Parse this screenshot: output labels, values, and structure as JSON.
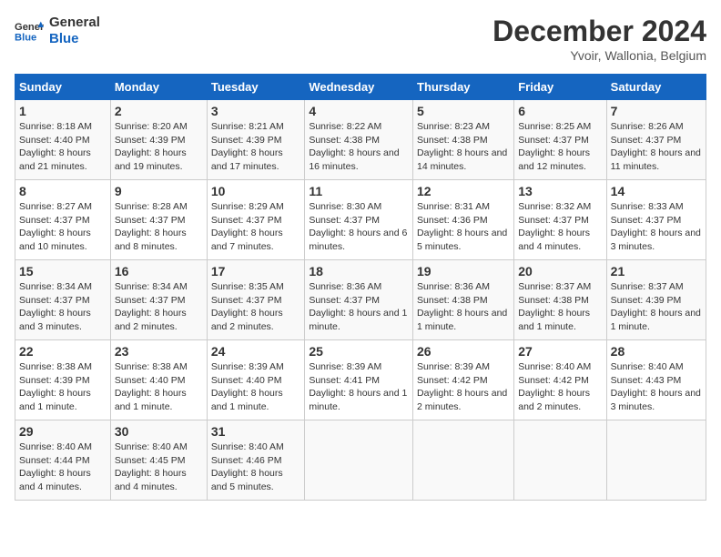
{
  "logo": {
    "text_general": "General",
    "text_blue": "Blue"
  },
  "header": {
    "month": "December 2024",
    "location": "Yvoir, Wallonia, Belgium"
  },
  "days_of_week": [
    "Sunday",
    "Monday",
    "Tuesday",
    "Wednesday",
    "Thursday",
    "Friday",
    "Saturday"
  ],
  "weeks": [
    [
      {
        "day": "1",
        "sunrise": "8:18 AM",
        "sunset": "4:40 PM",
        "daylight": "8 hours and 21 minutes."
      },
      {
        "day": "2",
        "sunrise": "8:20 AM",
        "sunset": "4:39 PM",
        "daylight": "8 hours and 19 minutes."
      },
      {
        "day": "3",
        "sunrise": "8:21 AM",
        "sunset": "4:39 PM",
        "daylight": "8 hours and 17 minutes."
      },
      {
        "day": "4",
        "sunrise": "8:22 AM",
        "sunset": "4:38 PM",
        "daylight": "8 hours and 16 minutes."
      },
      {
        "day": "5",
        "sunrise": "8:23 AM",
        "sunset": "4:38 PM",
        "daylight": "8 hours and 14 minutes."
      },
      {
        "day": "6",
        "sunrise": "8:25 AM",
        "sunset": "4:37 PM",
        "daylight": "8 hours and 12 minutes."
      },
      {
        "day": "7",
        "sunrise": "8:26 AM",
        "sunset": "4:37 PM",
        "daylight": "8 hours and 11 minutes."
      }
    ],
    [
      {
        "day": "8",
        "sunrise": "8:27 AM",
        "sunset": "4:37 PM",
        "daylight": "8 hours and 10 minutes."
      },
      {
        "day": "9",
        "sunrise": "8:28 AM",
        "sunset": "4:37 PM",
        "daylight": "8 hours and 8 minutes."
      },
      {
        "day": "10",
        "sunrise": "8:29 AM",
        "sunset": "4:37 PM",
        "daylight": "8 hours and 7 minutes."
      },
      {
        "day": "11",
        "sunrise": "8:30 AM",
        "sunset": "4:37 PM",
        "daylight": "8 hours and 6 minutes."
      },
      {
        "day": "12",
        "sunrise": "8:31 AM",
        "sunset": "4:36 PM",
        "daylight": "8 hours and 5 minutes."
      },
      {
        "day": "13",
        "sunrise": "8:32 AM",
        "sunset": "4:37 PM",
        "daylight": "8 hours and 4 minutes."
      },
      {
        "day": "14",
        "sunrise": "8:33 AM",
        "sunset": "4:37 PM",
        "daylight": "8 hours and 3 minutes."
      }
    ],
    [
      {
        "day": "15",
        "sunrise": "8:34 AM",
        "sunset": "4:37 PM",
        "daylight": "8 hours and 3 minutes."
      },
      {
        "day": "16",
        "sunrise": "8:34 AM",
        "sunset": "4:37 PM",
        "daylight": "8 hours and 2 minutes."
      },
      {
        "day": "17",
        "sunrise": "8:35 AM",
        "sunset": "4:37 PM",
        "daylight": "8 hours and 2 minutes."
      },
      {
        "day": "18",
        "sunrise": "8:36 AM",
        "sunset": "4:37 PM",
        "daylight": "8 hours and 1 minute."
      },
      {
        "day": "19",
        "sunrise": "8:36 AM",
        "sunset": "4:38 PM",
        "daylight": "8 hours and 1 minute."
      },
      {
        "day": "20",
        "sunrise": "8:37 AM",
        "sunset": "4:38 PM",
        "daylight": "8 hours and 1 minute."
      },
      {
        "day": "21",
        "sunrise": "8:37 AM",
        "sunset": "4:39 PM",
        "daylight": "8 hours and 1 minute."
      }
    ],
    [
      {
        "day": "22",
        "sunrise": "8:38 AM",
        "sunset": "4:39 PM",
        "daylight": "8 hours and 1 minute."
      },
      {
        "day": "23",
        "sunrise": "8:38 AM",
        "sunset": "4:40 PM",
        "daylight": "8 hours and 1 minute."
      },
      {
        "day": "24",
        "sunrise": "8:39 AM",
        "sunset": "4:40 PM",
        "daylight": "8 hours and 1 minute."
      },
      {
        "day": "25",
        "sunrise": "8:39 AM",
        "sunset": "4:41 PM",
        "daylight": "8 hours and 1 minute."
      },
      {
        "day": "26",
        "sunrise": "8:39 AM",
        "sunset": "4:42 PM",
        "daylight": "8 hours and 2 minutes."
      },
      {
        "day": "27",
        "sunrise": "8:40 AM",
        "sunset": "4:42 PM",
        "daylight": "8 hours and 2 minutes."
      },
      {
        "day": "28",
        "sunrise": "8:40 AM",
        "sunset": "4:43 PM",
        "daylight": "8 hours and 3 minutes."
      }
    ],
    [
      {
        "day": "29",
        "sunrise": "8:40 AM",
        "sunset": "4:44 PM",
        "daylight": "8 hours and 4 minutes."
      },
      {
        "day": "30",
        "sunrise": "8:40 AM",
        "sunset": "4:45 PM",
        "daylight": "8 hours and 4 minutes."
      },
      {
        "day": "31",
        "sunrise": "8:40 AM",
        "sunset": "4:46 PM",
        "daylight": "8 hours and 5 minutes."
      },
      null,
      null,
      null,
      null
    ]
  ]
}
